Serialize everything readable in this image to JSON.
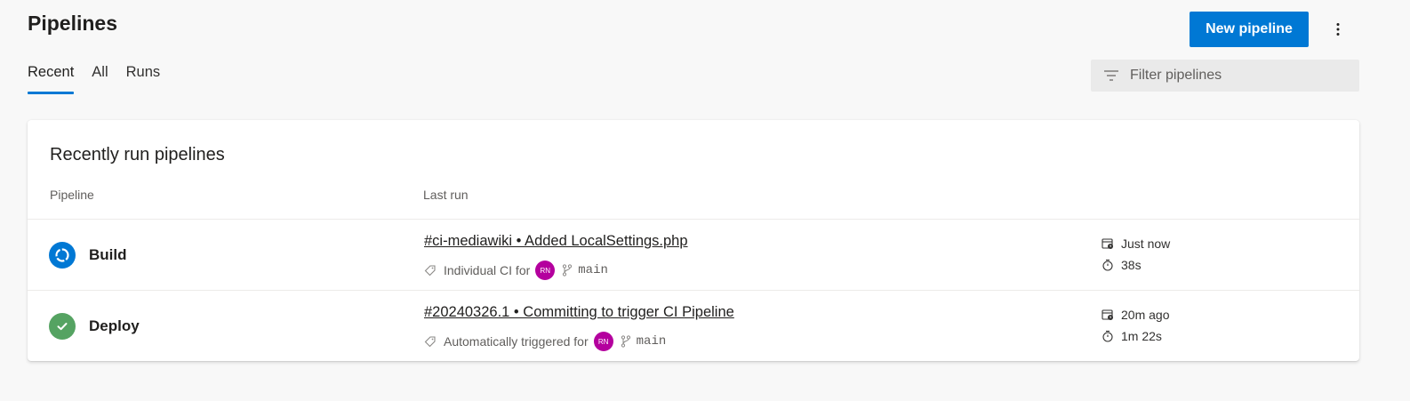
{
  "header": {
    "title": "Pipelines",
    "new_button_label": "New pipeline",
    "more_icon": "more-vertical-icon"
  },
  "tabs": [
    {
      "label": "Recent",
      "active": true
    },
    {
      "label": "All",
      "active": false
    },
    {
      "label": "Runs",
      "active": false
    }
  ],
  "filter": {
    "placeholder": "Filter pipelines",
    "value": "",
    "icon": "filter-icon"
  },
  "card": {
    "title": "Recently run pipelines",
    "columns": [
      "Pipeline",
      "Last run"
    ]
  },
  "rows": [
    {
      "name": "Build",
      "status": "running",
      "status_icon": "in-progress-icon",
      "status_color": "#0078d4",
      "run_title": "#ci-mediawiki • Added LocalSettings.php",
      "trigger": "Individual CI for",
      "avatar_initials": "RN",
      "branch": "main",
      "started": "Just now",
      "duration": "38s"
    },
    {
      "name": "Deploy",
      "status": "succeeded",
      "status_icon": "success-check-icon",
      "status_color": "#55a362",
      "run_title": "#20240326.1 • Committing to trigger CI Pipeline",
      "trigger": "Automatically triggered for",
      "avatar_initials": "RN",
      "branch": "main",
      "started": "20m ago",
      "duration": "1m 22s"
    }
  ],
  "colors": {
    "accent": "#0078d4",
    "avatar": "#b4009e",
    "success": "#55a362"
  }
}
